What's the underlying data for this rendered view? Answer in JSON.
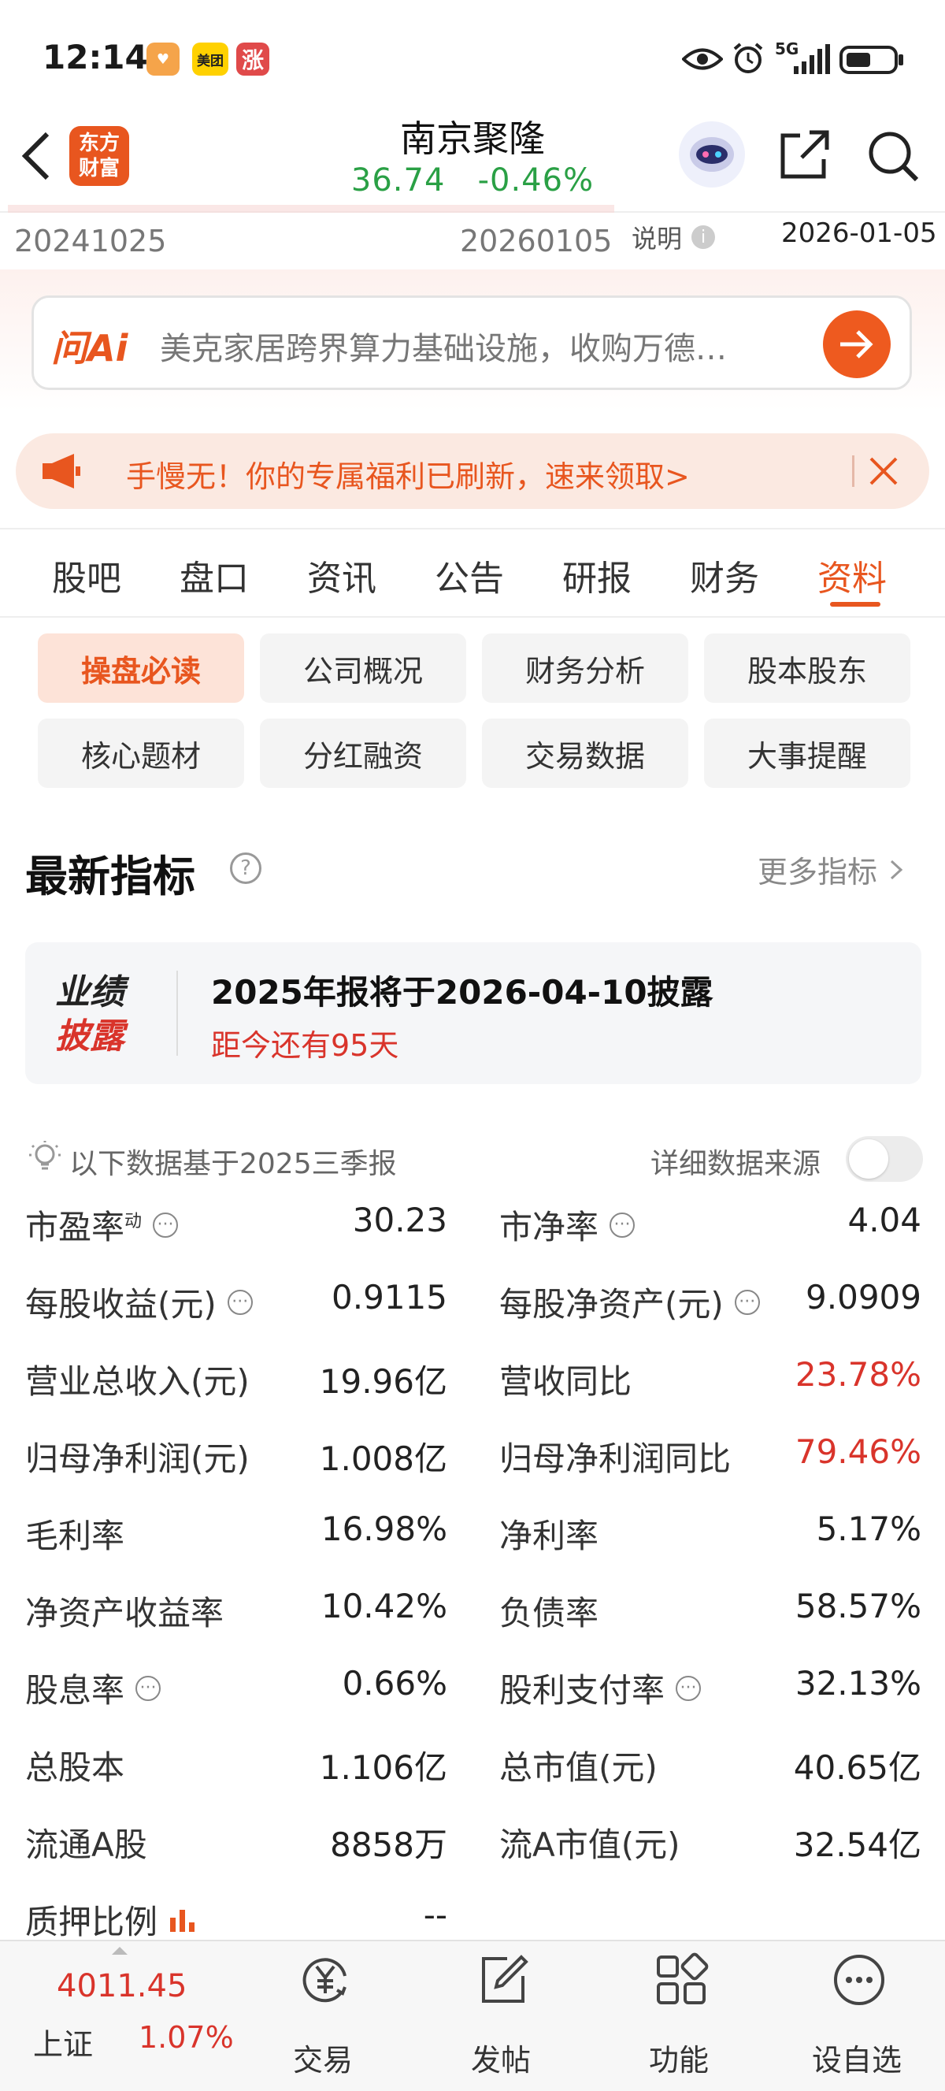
{
  "status_bar": {
    "time": "12:14",
    "app_icons": [
      "美团",
      "涨"
    ],
    "network": "5G"
  },
  "header": {
    "brand_line1": "东方",
    "brand_line2": "财富",
    "stock_name": "南京聚隆",
    "price": "36.74",
    "change_pct": "-0.46%"
  },
  "date_row": {
    "start": "20241025",
    "end": "20260105",
    "note_label": "说明",
    "date": "2026-01-05"
  },
  "ai_bar": {
    "logo": "问Ai",
    "text": "美克家居跨界算力基础设施，收购万德…"
  },
  "promo": {
    "text": "手慢无！你的专属福利已刷新，速来领取>"
  },
  "tabs": [
    "股吧",
    "盘口",
    "资讯",
    "公告",
    "研报",
    "财务",
    "资料"
  ],
  "active_tab": "资料",
  "chips": [
    "操盘必读",
    "公司概况",
    "财务分析",
    "股本股东",
    "核心题材",
    "分红融资",
    "交易数据",
    "大事提醒"
  ],
  "section": {
    "title": "最新指标",
    "more": "更多指标"
  },
  "perf": {
    "badge_line1": "业绩",
    "badge_line2": "披露",
    "headline": "2025年报将于2026-04-10披露",
    "countdown": "距今还有95天"
  },
  "data_note": {
    "text": "以下数据基于2025三季报",
    "source_label": "详细数据来源"
  },
  "metrics": {
    "pe_label": "市盈率",
    "pe_sup": "动",
    "pe": "30.23",
    "pb_label": "市净率",
    "pb": "4.04",
    "eps_label": "每股收益(元)",
    "eps": "0.9115",
    "bvps_label": "每股净资产(元)",
    "bvps": "9.0909",
    "rev_label": "营业总收入(元)",
    "rev": "19.96亿",
    "rev_yoy_label": "营收同比",
    "rev_yoy": "23.78%",
    "np_label": "归母净利润(元)",
    "np": "1.008亿",
    "np_yoy_label": "归母净利润同比",
    "np_yoy": "79.46%",
    "gm_label": "毛利率",
    "gm": "16.98%",
    "nm_label": "净利率",
    "nm": "5.17%",
    "roe_label": "净资产收益率",
    "roe": "10.42%",
    "debt_label": "负债率",
    "debt": "58.57%",
    "dy_label": "股息率",
    "dy": "0.66%",
    "payout_label": "股利支付率",
    "payout": "32.13%",
    "shares_label": "总股本",
    "shares": "1.106亿",
    "mcap_label": "总市值(元)",
    "mcap": "40.65亿",
    "float_label": "流通A股",
    "float": "8858万",
    "float_mcap_label": "流A市值(元)",
    "float_mcap": "32.54亿",
    "pledge_label": "质押比例",
    "pledge": "--"
  },
  "bottom_nav": {
    "index_value": "4011.45",
    "index_name": "上证",
    "index_pct": "1.07%",
    "trade": "交易",
    "post": "发帖",
    "func": "功能",
    "watch": "设自选"
  },
  "colors": {
    "accent": "#e8561f",
    "up": "#d9342b",
    "down": "#2aa045"
  }
}
